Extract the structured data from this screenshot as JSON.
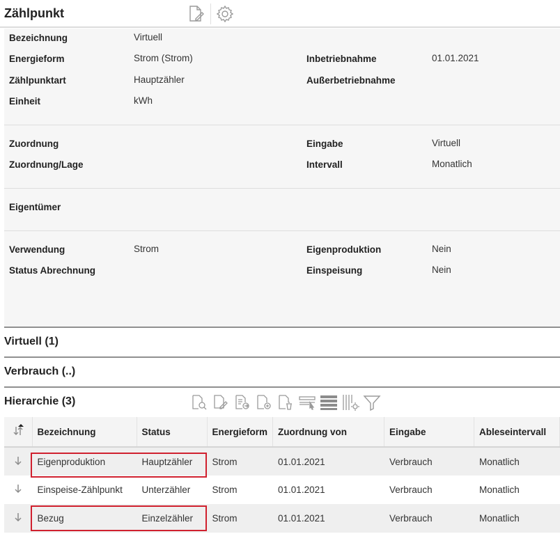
{
  "header": {
    "title": "Zählpunkt",
    "icons": [
      "edit-document-icon",
      "settings-gear-icon"
    ]
  },
  "details": {
    "bezeichnung": {
      "label": "Bezeichnung",
      "value": "Virtuell"
    },
    "energieform": {
      "label": "Energieform",
      "value": "Strom (Strom)"
    },
    "zaehlpunktart": {
      "label": "Zählpunktart",
      "value": "Hauptzähler"
    },
    "einheit": {
      "label": "Einheit",
      "value": "kWh"
    },
    "inbetriebnahme": {
      "label": "Inbetriebnahme",
      "value": "01.01.2021"
    },
    "ausserbetriebnahme": {
      "label": "Außerbetriebnahme",
      "value": ""
    },
    "zuordnung": {
      "label": "Zuordnung",
      "value": ""
    },
    "zuordnung_lage": {
      "label": "Zuordnung/Lage",
      "value": ""
    },
    "eingabe": {
      "label": "Eingabe",
      "value": "Virtuell"
    },
    "intervall": {
      "label": "Intervall",
      "value": "Monatlich"
    },
    "eigentuemer": {
      "label": "Eigentümer",
      "value": ""
    },
    "verwendung": {
      "label": "Verwendung",
      "value": "Strom"
    },
    "status_abrechnung": {
      "label": "Status Abrechnung",
      "value": ""
    },
    "eigenproduktion": {
      "label": "Eigenproduktion",
      "value": "Nein"
    },
    "einspeisung": {
      "label": "Einspeisung",
      "value": "Nein"
    }
  },
  "sections": {
    "virtuell": "Virtuell (1)",
    "verbrauch": "Verbrauch (..)",
    "hierarchie": "Hierarchie (3)"
  },
  "hierarchie_toolbar": [
    "preview-document-icon",
    "edit-document-icon",
    "export-document-icon",
    "add-document-icon",
    "delete-document-icon",
    "select-rows-icon",
    "list-view-icon",
    "column-settings-icon",
    "filter-icon"
  ],
  "table": {
    "columns": [
      "Bezeichnung",
      "Status",
      "Energieform",
      "Zuordnung von",
      "Eingabe",
      "Ableseintervall"
    ],
    "rows": [
      [
        "Eigenproduktion",
        "Hauptzähler",
        "Strom",
        "01.01.2021",
        "Verbrauch",
        "Monatlich"
      ],
      [
        "Einspeise-Zählpunkt",
        "Unterzähler",
        "Strom",
        "01.01.2021",
        "Verbrauch",
        "Monatlich"
      ],
      [
        "Bezug",
        "Einzelzähler",
        "Strom",
        "01.01.2021",
        "Verbrauch",
        "Monatlich"
      ]
    ]
  },
  "colors": {
    "highlight": "#d0202e",
    "section_border": "#8f8f8f",
    "detail_bg": "#f6f6f6",
    "icon_gray": "#9a9a9a"
  }
}
